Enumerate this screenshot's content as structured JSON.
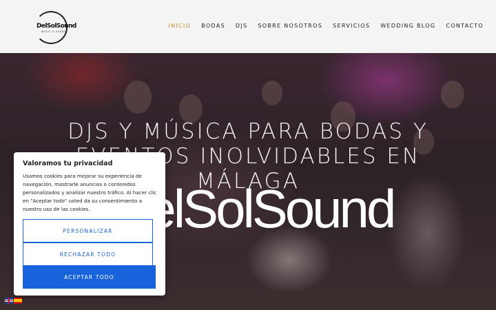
{
  "header": {
    "logo": {
      "wordmark": "DelSolSound",
      "tagline": "MUSIC & EVENTS"
    },
    "nav": [
      {
        "label": "INICIO",
        "active": true
      },
      {
        "label": "BODAS",
        "active": false
      },
      {
        "label": "DJS",
        "active": false
      },
      {
        "label": "SOBRE NOSOTROS",
        "active": false
      },
      {
        "label": "SERVICIOS",
        "active": false
      },
      {
        "label": "WEDDING BLOG",
        "active": false
      },
      {
        "label": "CONTACTO",
        "active": false
      }
    ],
    "active_color": "#c98c2c"
  },
  "hero": {
    "title": "DJS Y MÚSICA PARA BODAS Y EVENTOS INOLVIDABLES EN MÁLAGA",
    "brand": "DelSolSound"
  },
  "cookie_banner": {
    "title": "Valoramos tu privacidad",
    "text": "Usamos cookies para mejorar su experiencia de navegación, mostrarle anuncios o contenidos personalizados y analizar nuestro tráfico. Al hacer clic en \"Aceptar todo\" usted da su consentimiento a nuestro uso de las cookies.",
    "buttons": {
      "customize": "PERSONALIZAR",
      "reject": "RECHAZAR TODO",
      "accept": "ACEPTAR TODO"
    },
    "accent_color": "#1863dc"
  },
  "language_flags": [
    "english-flag-icon",
    "spanish-flag-icon"
  ]
}
